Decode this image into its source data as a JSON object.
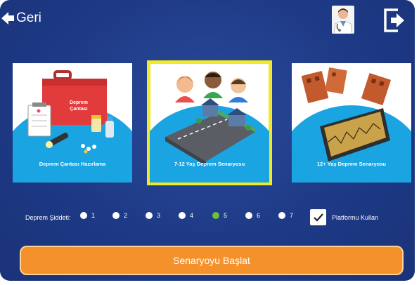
{
  "header": {
    "back_label": "Geri",
    "avatar_icon": "doctor-avatar-icon",
    "exit_icon": "exit-icon"
  },
  "scenarios": [
    {
      "label": "Deprem Çantası Hazırlama",
      "bag_text": "Deprem Çantası",
      "selected": false
    },
    {
      "label": "7-12 Yaş Deprem Senaryosu",
      "selected": true
    },
    {
      "label": "12+ Yaş Deprem Senaryosu",
      "selected": false
    }
  ],
  "severity": {
    "label": "Deprem Şiddeti:",
    "options": [
      "1",
      "2",
      "3",
      "4",
      "5",
      "6",
      "7"
    ],
    "selected": "5"
  },
  "platform": {
    "label": "Platformu Kullan",
    "checked": true
  },
  "start_label": "Senaryoyu Başlat",
  "colors": {
    "selection": "#f0ea2a",
    "radio_active": "#6fbf3c",
    "start_button": "#f5912b",
    "dome": "#1aa4e2"
  }
}
